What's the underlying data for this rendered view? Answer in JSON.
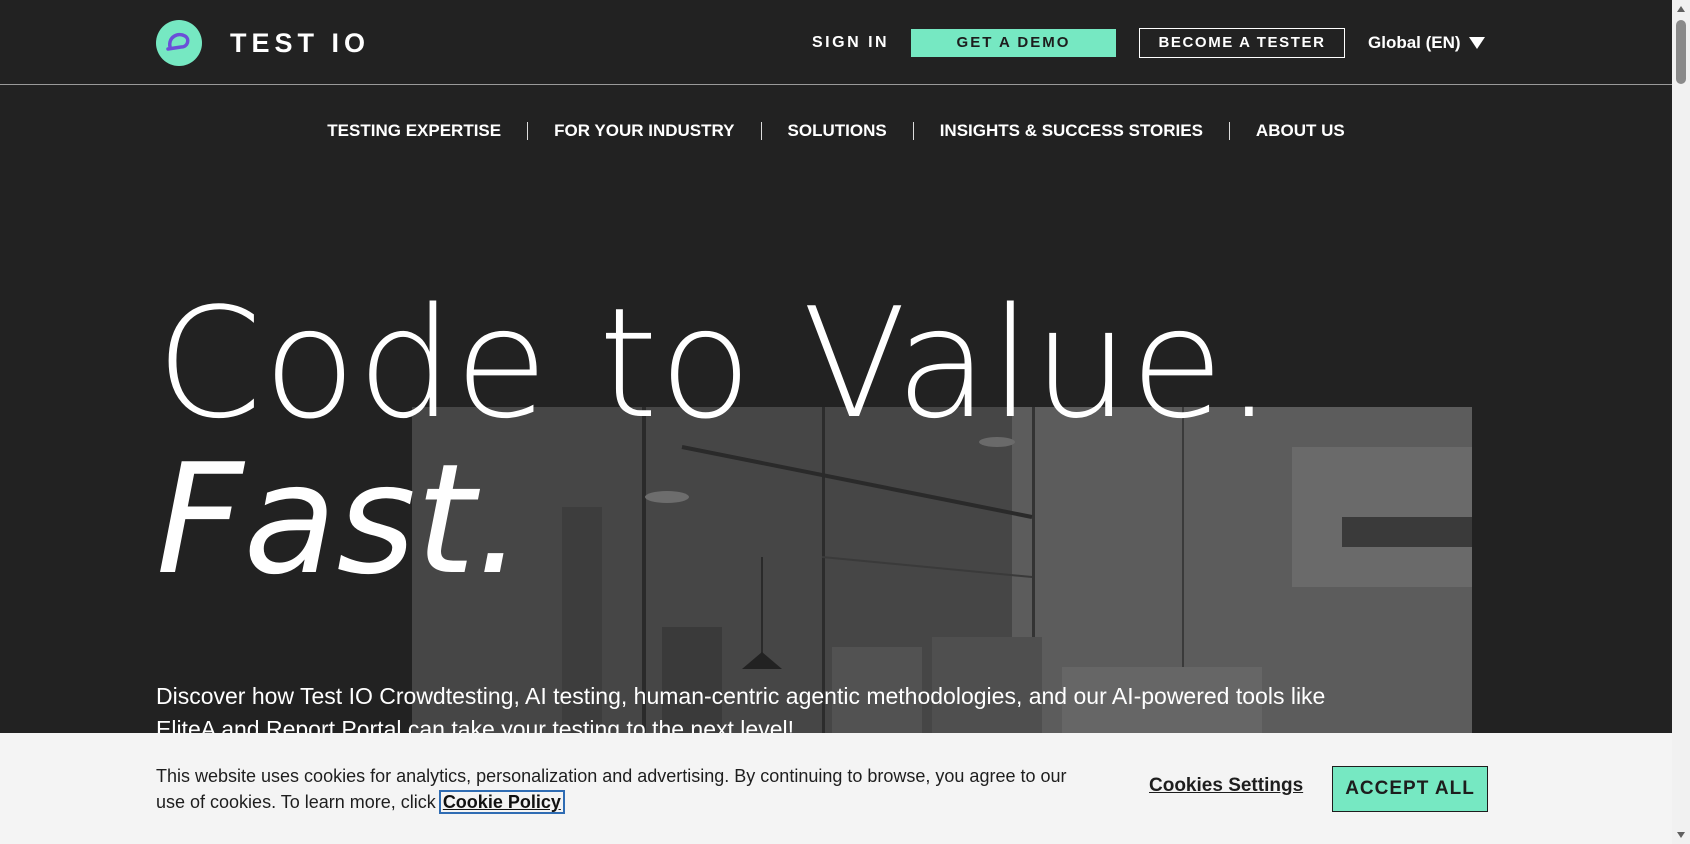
{
  "header": {
    "logo_text": "TEST IO",
    "sign_in": "SIGN IN",
    "get_demo": "GET A DEMO",
    "become_tester": "BECOME A TESTER",
    "region": "Global (EN)"
  },
  "nav": {
    "items": [
      {
        "label": "TESTING EXPERTISE"
      },
      {
        "label": "FOR YOUR INDUSTRY"
      },
      {
        "label": "SOLUTIONS"
      },
      {
        "label": "INSIGHTS & SUCCESS STORIES"
      },
      {
        "label": "ABOUT US"
      }
    ]
  },
  "hero": {
    "headline_line1": "Code to Value.",
    "headline_line2": "Fast.",
    "description": "Discover how Test IO Crowdtesting, AI testing, human-centric agentic methodologies, and our AI-powered tools like EliteA and Report Portal can take your testing to the next level!"
  },
  "cookie_banner": {
    "text": "This website uses cookies for analytics, personalization and advertising. By continuing to browse, you agree to our use of cookies. To learn more, click",
    "policy_link": "Cookie Policy",
    "settings": "Cookies Settings",
    "accept": "ACCEPT ALL"
  },
  "colors": {
    "background": "#222222",
    "accent": "#76e8c2",
    "banner": "#f4f4f4"
  }
}
